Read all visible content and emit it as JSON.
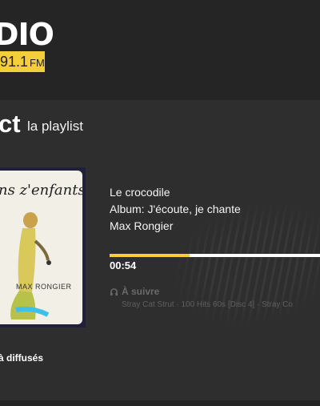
{
  "header": {
    "logo": "DIO",
    "frequency": "91.1",
    "frequency_unit": "FM"
  },
  "section": {
    "title_bold": "ct",
    "title_sub": "la playlist"
  },
  "cover": {
    "title": "ns z'enfants",
    "artist": "MAX RONGIER"
  },
  "track": {
    "title": "Le crocodile",
    "album": "Album: J'écoute, je chante",
    "artist": "Max Rongier"
  },
  "player": {
    "time": "00:54",
    "progress": 0.38
  },
  "up_next": {
    "label": "À suivre",
    "tracks": "Stray Cat Strut · 100 Hits 60s [Disc 4] · Stray Co"
  },
  "history": {
    "label": "à diffusés"
  },
  "colors": {
    "accent": "#f5cf3b",
    "background": "#2e2e2e",
    "header_bg": "#252525"
  }
}
